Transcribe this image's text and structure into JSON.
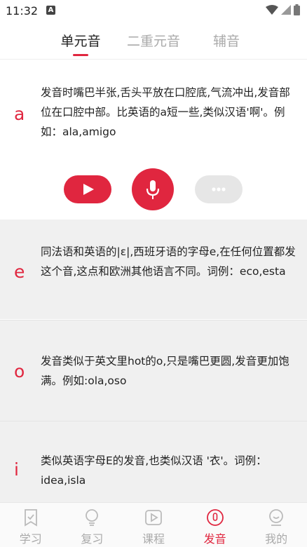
{
  "status_bar": {
    "time": "11:32",
    "notif_letter": "A"
  },
  "tabs": [
    {
      "label": "单元音",
      "active": true
    },
    {
      "label": "二重元音",
      "active": false
    },
    {
      "label": "辅音",
      "active": false
    }
  ],
  "vowels": [
    {
      "letter": "a",
      "description": "发音时嘴巴半张,舌头平放在口腔底,气流冲出,发音部位在口腔中部。比英语的a短一些,类似汉语'啊'。例如：ala,amigo"
    },
    {
      "letter": "e",
      "description": "同法语和英语的|ɛ|,西班牙语的字母e,在任何位置都发这个音,这点和欧洲其他语言不同。词例：eco,esta"
    },
    {
      "letter": "o",
      "description": "发音类似于英文里hot的o,只是嘴巴更圆,发音更加饱满。例如:ola,oso"
    },
    {
      "letter": "i",
      "description": "类似英语字母E的发音,也类似汉语 '衣'。词例：idea,isla"
    }
  ],
  "bottom_nav": [
    {
      "label": "学习",
      "icon": "bookmark-icon",
      "active": false
    },
    {
      "label": "复习",
      "icon": "lightbulb-icon",
      "active": false
    },
    {
      "label": "课程",
      "icon": "play-square-icon",
      "active": false
    },
    {
      "label": "发音",
      "icon": "pronounce-icon",
      "active": true
    },
    {
      "label": "我的",
      "icon": "profile-icon",
      "active": false
    }
  ],
  "colors": {
    "accent": "#e0263f",
    "inactive": "#aaaaaa",
    "card_bg": "#f0f0f0"
  }
}
